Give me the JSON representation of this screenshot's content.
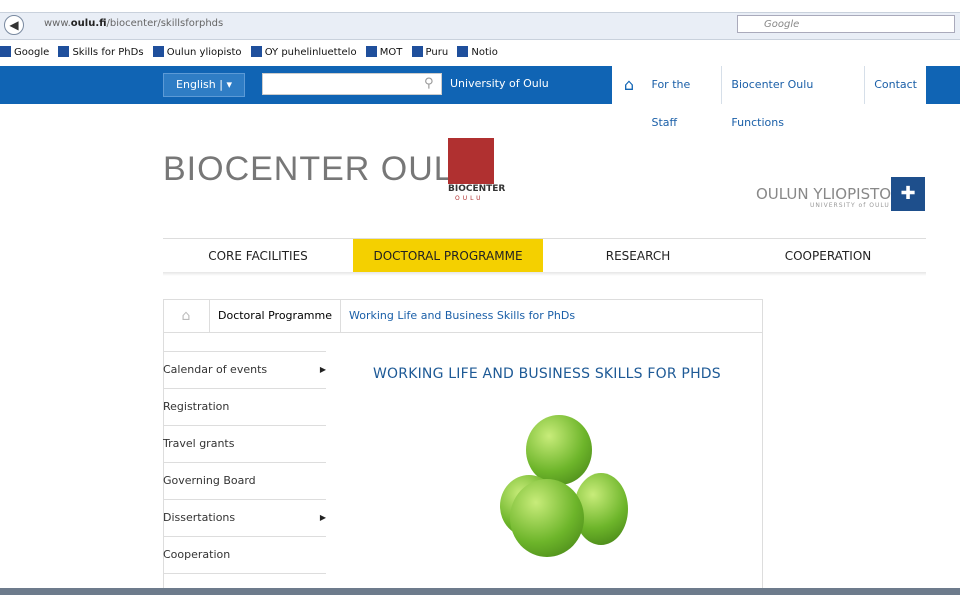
{
  "browser": {
    "url_prefix": "www.",
    "url_domain": "oulu.fi",
    "url_path": "/biocenter/skillsforphds",
    "search_placeholder": "Google",
    "bookmarks": [
      "Google",
      "Skills for PhDs",
      "Oulun yliopisto",
      "OY puhelinluettelo",
      "MOT",
      "Puru",
      "Notio"
    ]
  },
  "topbar": {
    "language": "English",
    "university_link": "University of Oulu",
    "right_links": [
      "For the Staff",
      "Biocenter Oulu Functions",
      "Contact"
    ]
  },
  "header": {
    "logo_text": "BIOCENTER OULU",
    "logomark_text": "BIOCENTER",
    "logomark_sub": "OULU",
    "university_name": "OULUN YLIOPISTO",
    "university_sub": "UNIVERSITY of OULU"
  },
  "main_nav": [
    "CORE FACILITIES",
    "DOCTORAL PROGRAMME",
    "RESEARCH",
    "COOPERATION"
  ],
  "breadcrumb": [
    "Doctoral Programme",
    "Working Life and Business Skills for PhDs"
  ],
  "side_menu": [
    {
      "label": "Calendar of events",
      "has_sub": true
    },
    {
      "label": "Registration",
      "has_sub": false
    },
    {
      "label": "Travel grants",
      "has_sub": false
    },
    {
      "label": "Governing Board",
      "has_sub": false
    },
    {
      "label": "Dissertations",
      "has_sub": true
    },
    {
      "label": "Cooperation",
      "has_sub": false
    }
  ],
  "article": {
    "title": "WORKING LIFE AND BUSINESS SKILLS FOR PHDS"
  },
  "colors": {
    "topbar": "#1064b4",
    "active_nav": "#f4d000",
    "link": "#1a5fa8"
  }
}
